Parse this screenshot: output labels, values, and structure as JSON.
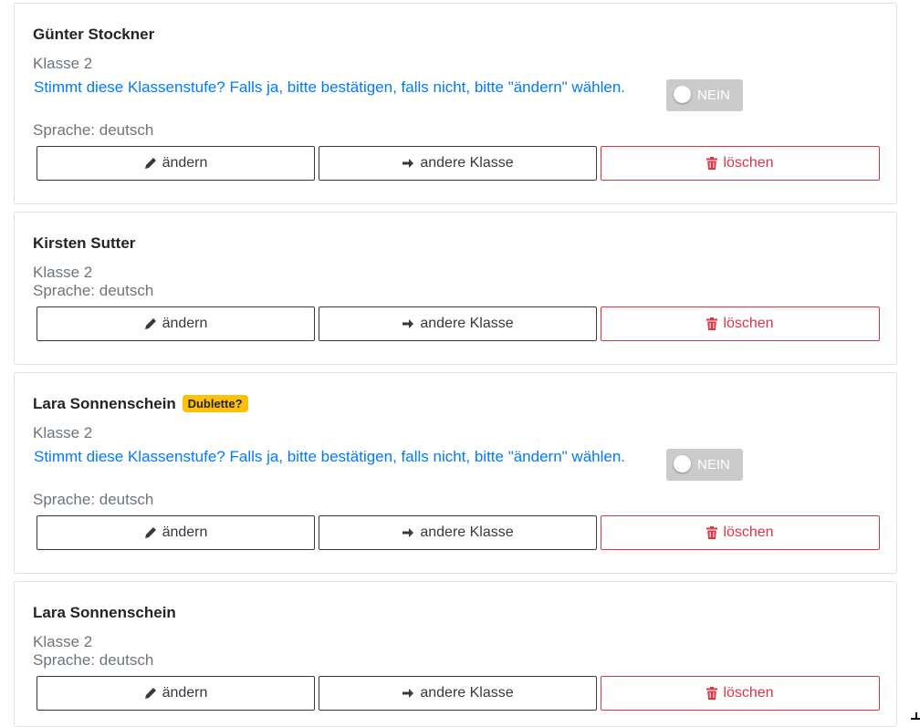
{
  "students": [
    {
      "name": "Günter Stockner",
      "badge": "",
      "class_label": "Klasse 2",
      "question": "Stimmt diese Klassenstufe? Falls ja, bitte bestätigen, falls nicht, bitte \"ändern\" wählen.",
      "toggle_label": "NEIN",
      "language_label": "Sprache: deutsch"
    },
    {
      "name": "Kirsten Sutter",
      "badge": "",
      "class_label": "Klasse 2",
      "language_label": "Sprache: deutsch"
    },
    {
      "name": "Lara Sonnenschein",
      "badge": "Dublette?",
      "class_label": "Klasse 2",
      "question": "Stimmt diese Klassenstufe? Falls ja, bitte bestätigen, falls nicht, bitte \"ändern\" wählen.",
      "toggle_label": "NEIN",
      "language_label": "Sprache: deutsch"
    },
    {
      "name": "Lara Sonnenschein",
      "badge": "",
      "class_label": "Klasse 2",
      "language_label": "Sprache: deutsch"
    }
  ],
  "buttons": {
    "edit_label": "ändern",
    "move_label": "andere Klasse",
    "delete_label": "löschen"
  },
  "icons": {
    "edit": "pencil-icon",
    "move": "arrow-right-icon",
    "delete": "trash-icon"
  },
  "colors": {
    "primary_text": "#007bff",
    "muted_text": "#6c757d",
    "danger": "#dc3545",
    "warning_badge": "#ffc107",
    "toggle_off": "#cbcbcb"
  }
}
